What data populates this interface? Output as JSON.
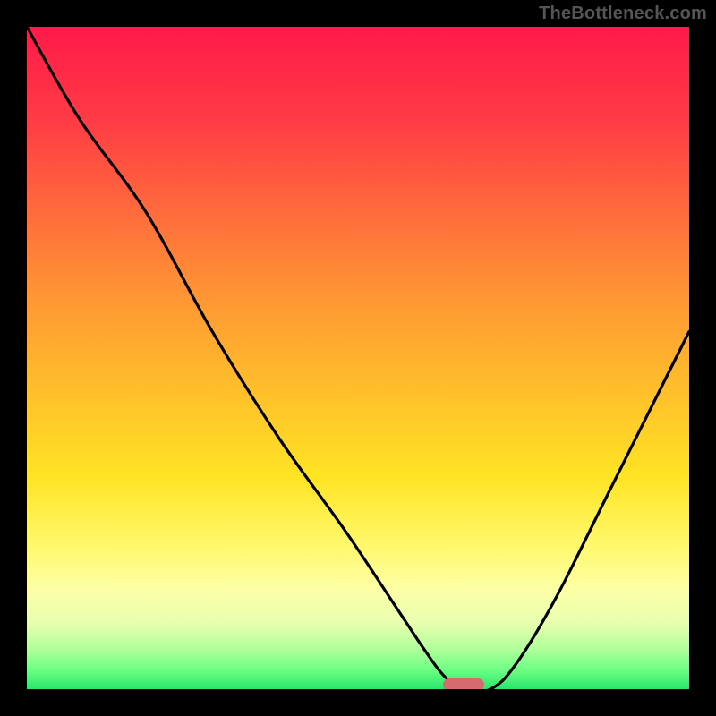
{
  "watermark": "TheBottleneck.com",
  "chart_data": {
    "type": "line",
    "title": "",
    "xlabel": "",
    "ylabel": "",
    "xlim": [
      0,
      100
    ],
    "ylim": [
      0,
      100
    ],
    "grid": false,
    "background": "heat-gradient",
    "series": [
      {
        "name": "bottleneck-curve",
        "x": [
          0,
          8,
          18,
          28,
          38,
          48,
          56,
          60,
          63,
          66,
          70,
          74,
          80,
          88,
          96,
          100
        ],
        "y": [
          100,
          86,
          72,
          54,
          38,
          24,
          12,
          6,
          2,
          0,
          0,
          4,
          14,
          30,
          46,
          54
        ]
      }
    ],
    "marker": {
      "x": 66,
      "y": 0,
      "color": "#d56a6f"
    },
    "gradient_stops": [
      {
        "pos": 0,
        "color": "#ff1a49"
      },
      {
        "pos": 14,
        "color": "#ff3b45"
      },
      {
        "pos": 28,
        "color": "#ff6b3c"
      },
      {
        "pos": 42,
        "color": "#ff9a33"
      },
      {
        "pos": 56,
        "color": "#ffc22a"
      },
      {
        "pos": 68,
        "color": "#ffe424"
      },
      {
        "pos": 78,
        "color": "#fff86a"
      },
      {
        "pos": 85,
        "color": "#fdffa6"
      },
      {
        "pos": 90,
        "color": "#e8ffb0"
      },
      {
        "pos": 94,
        "color": "#b0ff9a"
      },
      {
        "pos": 97,
        "color": "#6fff84"
      },
      {
        "pos": 100,
        "color": "#28e66b"
      }
    ]
  }
}
